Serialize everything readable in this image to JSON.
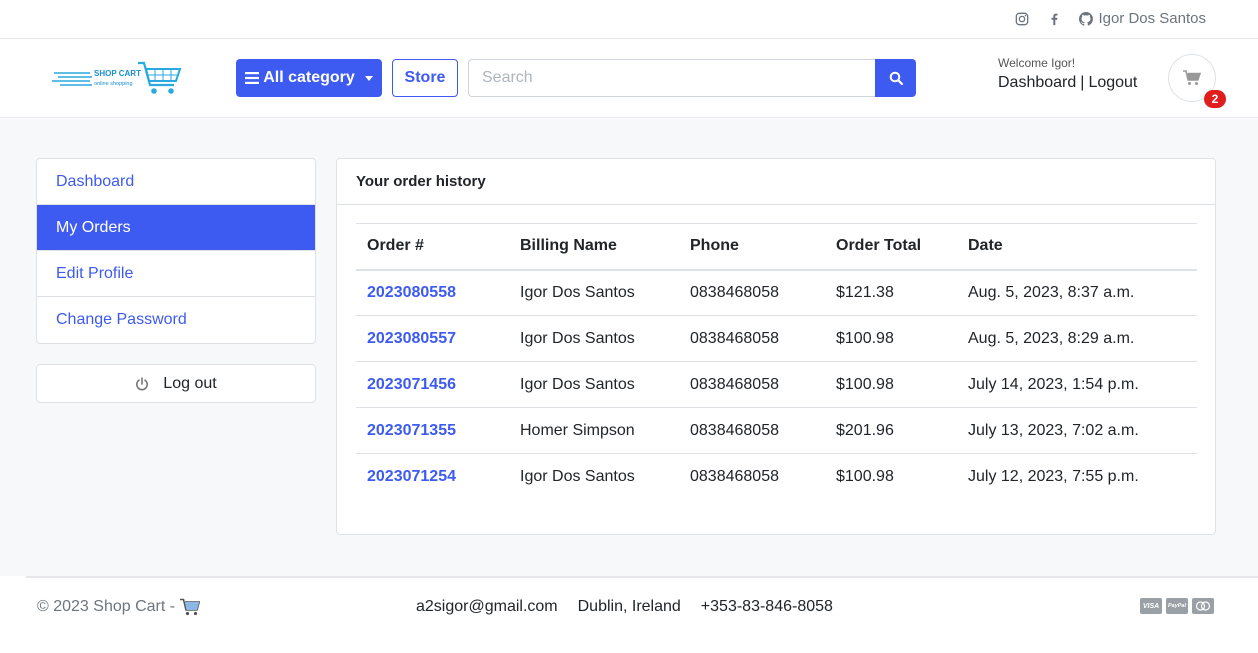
{
  "topbar": {
    "user_name": "Igor Dos Santos",
    "icons": [
      "instagram-icon",
      "facebook-icon",
      "github-icon"
    ]
  },
  "header": {
    "logo_text": "SHOP CART",
    "logo_tagline": "online shopping",
    "category_button": "All category",
    "store_button": "Store",
    "search_placeholder": "Search",
    "welcome": "Welcome Igor!",
    "dashboard_link": "Dashboard",
    "separator": "|",
    "logout_link": "Logout",
    "cart_count": "2"
  },
  "sidebar": {
    "items": [
      {
        "label": "Dashboard",
        "active": false
      },
      {
        "label": "My Orders",
        "active": true
      },
      {
        "label": "Edit Profile",
        "active": false
      },
      {
        "label": "Change Password",
        "active": false
      }
    ],
    "logout_label": "Log out"
  },
  "orders": {
    "title": "Your order history",
    "columns": [
      "Order #",
      "Billing Name",
      "Phone",
      "Order Total",
      "Date"
    ],
    "rows": [
      {
        "order": "2023080558",
        "name": "Igor Dos Santos",
        "phone": "0838468058",
        "total": "$121.38",
        "date": "Aug. 5, 2023, 8:37 a.m."
      },
      {
        "order": "2023080557",
        "name": "Igor Dos Santos",
        "phone": "0838468058",
        "total": "$100.98",
        "date": "Aug. 5, 2023, 8:29 a.m."
      },
      {
        "order": "2023071456",
        "name": "Igor Dos Santos",
        "phone": "0838468058",
        "total": "$100.98",
        "date": "July 14, 2023, 1:54 p.m."
      },
      {
        "order": "2023071355",
        "name": "Homer Simpson",
        "phone": "0838468058",
        "total": "$201.96",
        "date": "July 13, 2023, 7:02 a.m."
      },
      {
        "order": "2023071254",
        "name": "Igor Dos Santos",
        "phone": "0838468058",
        "total": "$100.98",
        "date": "July 12, 2023, 7:55 p.m."
      }
    ]
  },
  "footer": {
    "copyright": "© 2023 Shop Cart -",
    "email": "a2sigor@gmail.com",
    "location": "Dublin, Ireland",
    "phone": "+353-83-846-8058",
    "payments": [
      "VISA",
      "PayPal",
      "MC"
    ]
  },
  "colors": {
    "accent": "#3d5af1",
    "badge": "#e21d1d",
    "background": "#f7f8fa"
  }
}
